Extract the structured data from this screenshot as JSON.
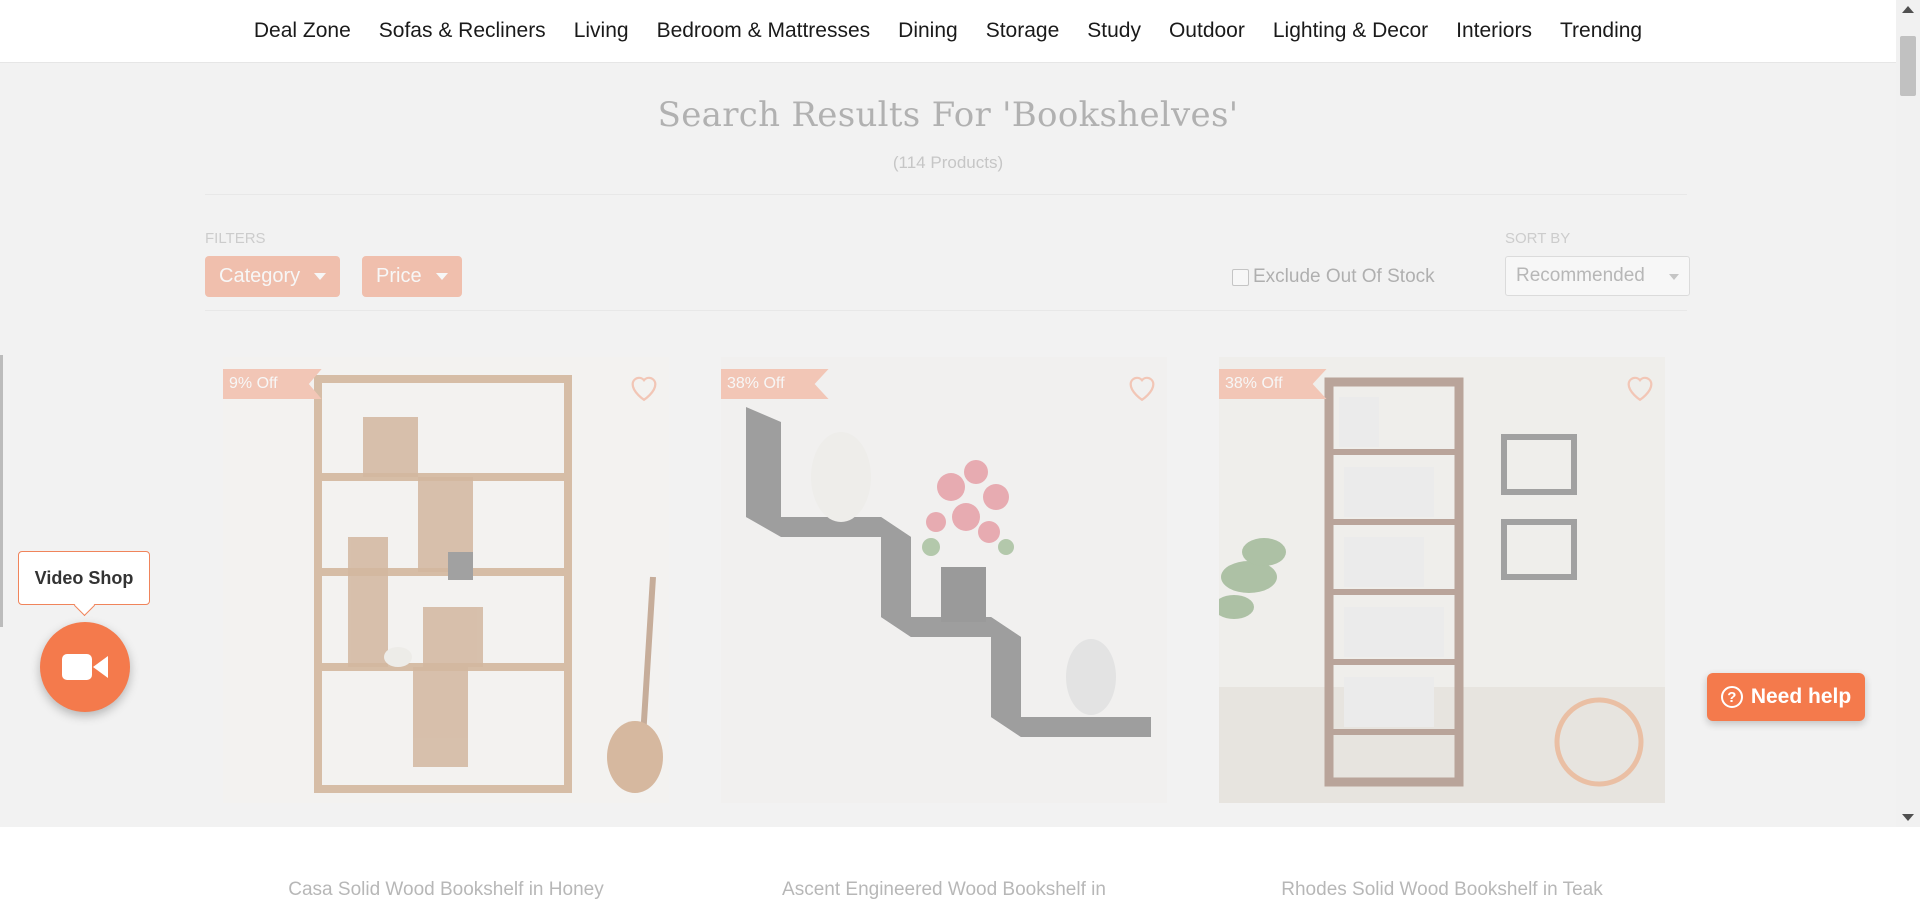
{
  "nav": {
    "items": [
      {
        "label": "Deal Zone"
      },
      {
        "label": "Sofas & Recliners"
      },
      {
        "label": "Living"
      },
      {
        "label": "Bedroom & Mattresses"
      },
      {
        "label": "Dining"
      },
      {
        "label": "Storage"
      },
      {
        "label": "Study"
      },
      {
        "label": "Outdoor"
      },
      {
        "label": "Lighting & Decor"
      },
      {
        "label": "Interiors"
      },
      {
        "label": "Trending"
      }
    ]
  },
  "results": {
    "title": "Search Results For 'Bookshelves'",
    "count": "(114 Products)"
  },
  "filters": {
    "label": "FILTERS",
    "category_label": "Category",
    "price_label": "Price",
    "exclude_label": "Exclude Out Of Stock",
    "exclude_checked": false
  },
  "sort": {
    "label": "SORT BY",
    "selected": "Recommended"
  },
  "products": [
    {
      "discount": "9% Off",
      "name": "Casa Solid Wood Bookshelf in Honey",
      "image": "wooden-zigzag-bookshelf"
    },
    {
      "discount": "38% Off",
      "name": "Ascent Engineered Wood Bookshelf in",
      "image": "black-step-wall-shelf"
    },
    {
      "discount": "38% Off",
      "name": "Rhodes Solid Wood Bookshelf in Teak",
      "image": "tall-wooden-bookshelf"
    }
  ],
  "video_shop": {
    "label": "Video Shop",
    "icon": "video-camera-icon"
  },
  "help": {
    "label": "Need help",
    "icon": "question-circle-icon"
  },
  "colors": {
    "accent": "#f47a4c",
    "overlay_bg": "#f2f2f2",
    "badge": "#f28b64"
  }
}
